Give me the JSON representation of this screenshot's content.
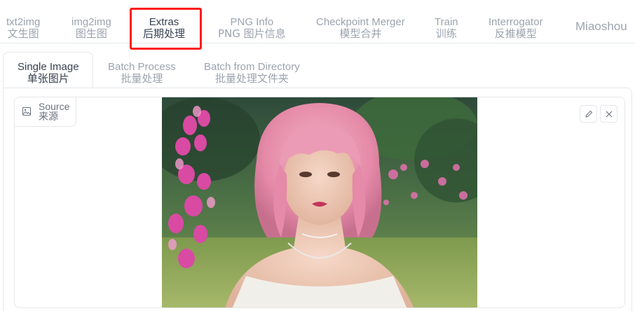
{
  "top_tabs": [
    {
      "en": "txt2img",
      "zh": "文生图"
    },
    {
      "en": "img2img",
      "zh": "图生图"
    },
    {
      "en": "Extras",
      "zh": "后期处理"
    },
    {
      "en": "PNG Info",
      "zh": "PNG 图片信息"
    },
    {
      "en": "Checkpoint Merger",
      "zh": "模型合并"
    },
    {
      "en": "Train",
      "zh": "训练"
    },
    {
      "en": "Interrogator",
      "zh": "反推模型"
    },
    {
      "en": "Miaoshou"
    }
  ],
  "active_top_tab": "Extras",
  "sub_tabs": [
    {
      "en": "Single Image",
      "zh": "单张图片"
    },
    {
      "en": "Batch Process",
      "zh": "批量处理"
    },
    {
      "en": "Batch from Directory",
      "zh": "批量处理文件夹"
    }
  ],
  "active_sub_tab": "Single Image",
  "image_input": {
    "label_en": "Source",
    "label_zh": "来源",
    "label_icon": "image-icon",
    "edit_icon": "pencil-icon",
    "clear_icon": "close-icon"
  },
  "colors": {
    "highlight": "#ff1a1a",
    "inactive_text": "#9ca3af",
    "active_text": "#374151"
  }
}
